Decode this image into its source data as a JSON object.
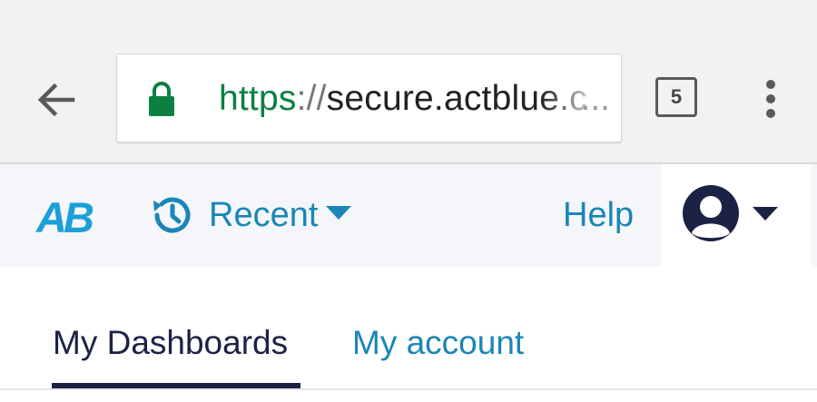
{
  "browser": {
    "url_scheme": "https",
    "url_separator": "://",
    "url_host": "secure.actblue.c",
    "url_ellipsis": "...",
    "tab_count": "5",
    "scheme_color": "#0b8043",
    "icons": [
      "back-arrow-icon",
      "lock-icon",
      "tab-switcher-icon",
      "more-vert-icon"
    ]
  },
  "nav": {
    "logo": "AB",
    "recent_label": "Recent",
    "help_label": "Help",
    "brand_color": "#1b9fd8",
    "link_color": "#1a86b8",
    "icons": [
      "history-icon",
      "caret-down-icon",
      "user-avatar-icon"
    ]
  },
  "tabs": [
    {
      "label": "My Dashboards",
      "active": true
    },
    {
      "label": "My account",
      "active": false
    }
  ]
}
